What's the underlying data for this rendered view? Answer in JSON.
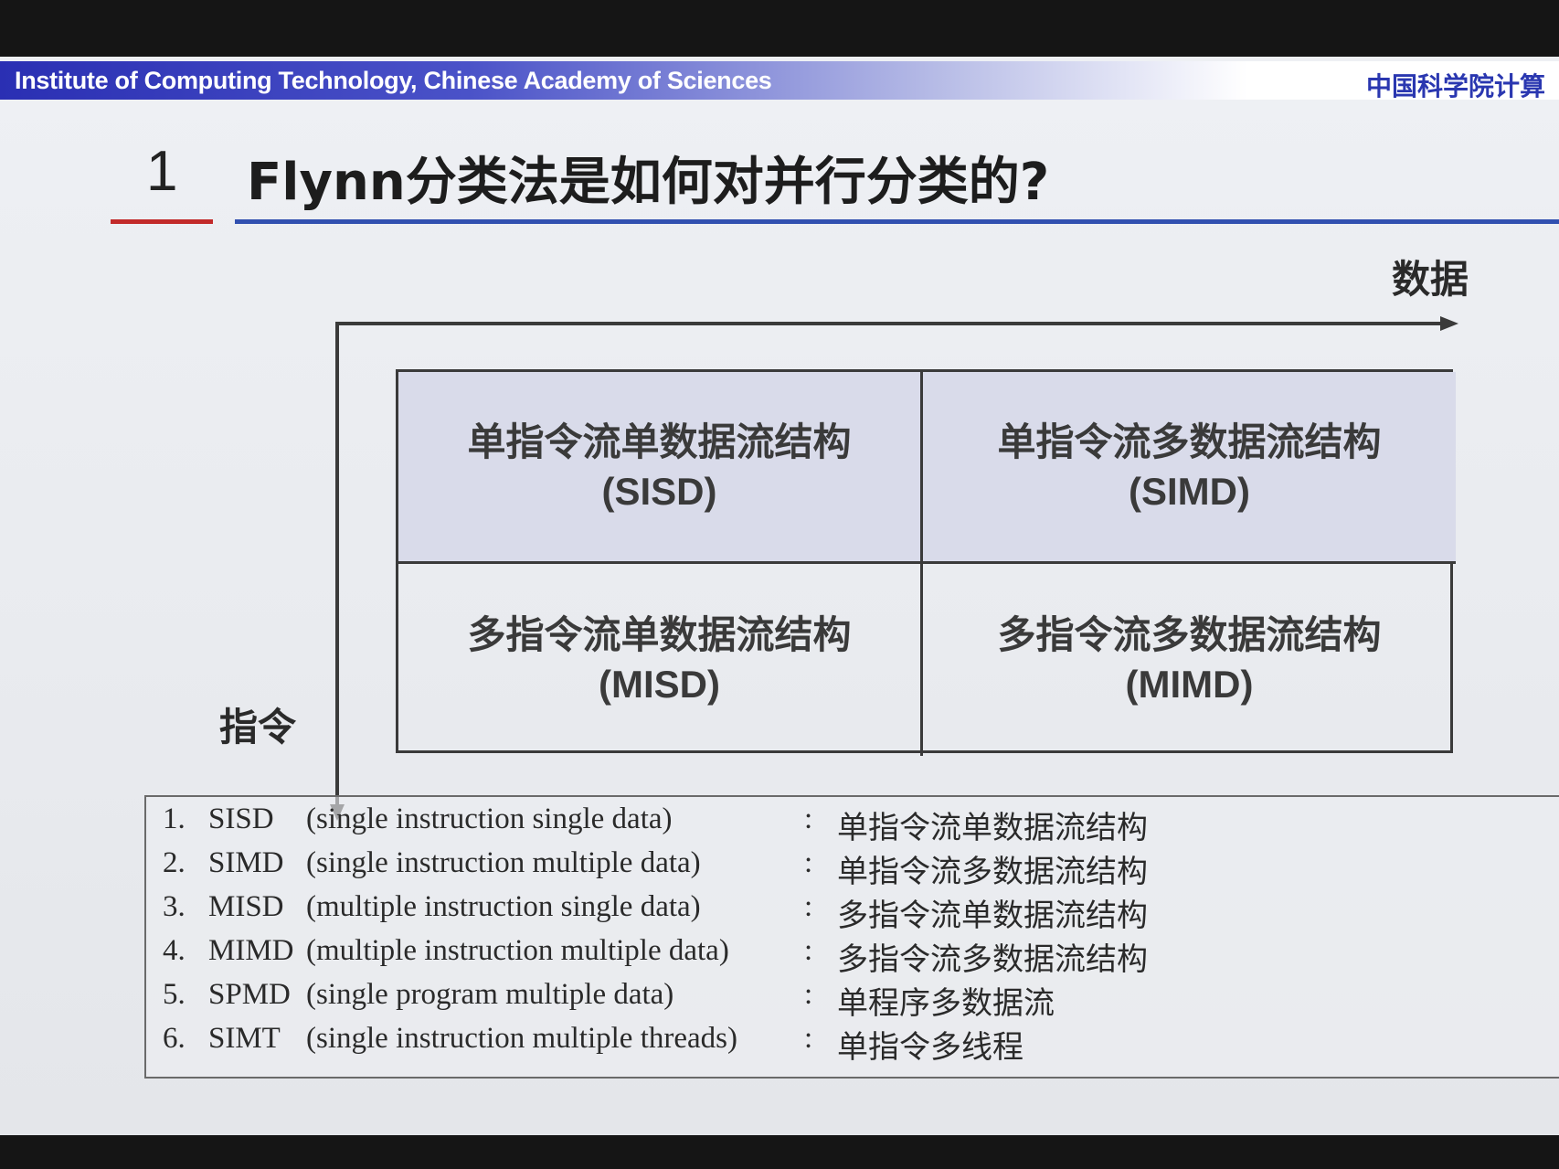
{
  "header": {
    "institution_en": "Institute of Computing Technology, Chinese Academy of Sciences",
    "institution_zh": "中国科学院计算"
  },
  "section": {
    "number": "1",
    "title": "Flynn分类法是如何对并行分类的?"
  },
  "axes": {
    "horizontal_label": "数据",
    "vertical_label": "指令"
  },
  "quadrants": [
    {
      "zh": "单指令流单数据流结构",
      "abbr": "(SISD)"
    },
    {
      "zh": "单指令流多数据流结构",
      "abbr": "(SIMD)"
    },
    {
      "zh": "多指令流单数据流结构",
      "abbr": "(MISD)"
    },
    {
      "zh": "多指令流多数据流结构",
      "abbr": "(MIMD)"
    }
  ],
  "legend": [
    {
      "num": "1.",
      "abbr": "SISD",
      "full": "(single instruction single data)",
      "colon": ":",
      "zh": "单指令流单数据流结构"
    },
    {
      "num": "2.",
      "abbr": "SIMD",
      "full": "(single instruction multiple data)",
      "colon": ":",
      "zh": "单指令流多数据流结构"
    },
    {
      "num": "3.",
      "abbr": "MISD",
      "full": "(multiple instruction single data)",
      "colon": ":",
      "zh": "多指令流单数据流结构"
    },
    {
      "num": "4.",
      "abbr": "MIMD",
      "full": "(multiple instruction multiple data)",
      "colon": ":",
      "zh": "多指令流多数据流结构"
    },
    {
      "num": "5.",
      "abbr": "SPMD",
      "full": "(single program multiple data)",
      "colon": ":",
      "zh": "单程序多数据流"
    },
    {
      "num": "6.",
      "abbr": "SIMT",
      "full": "(single instruction multiple threads)",
      "colon": ":",
      "zh": "单指令多线程"
    }
  ]
}
